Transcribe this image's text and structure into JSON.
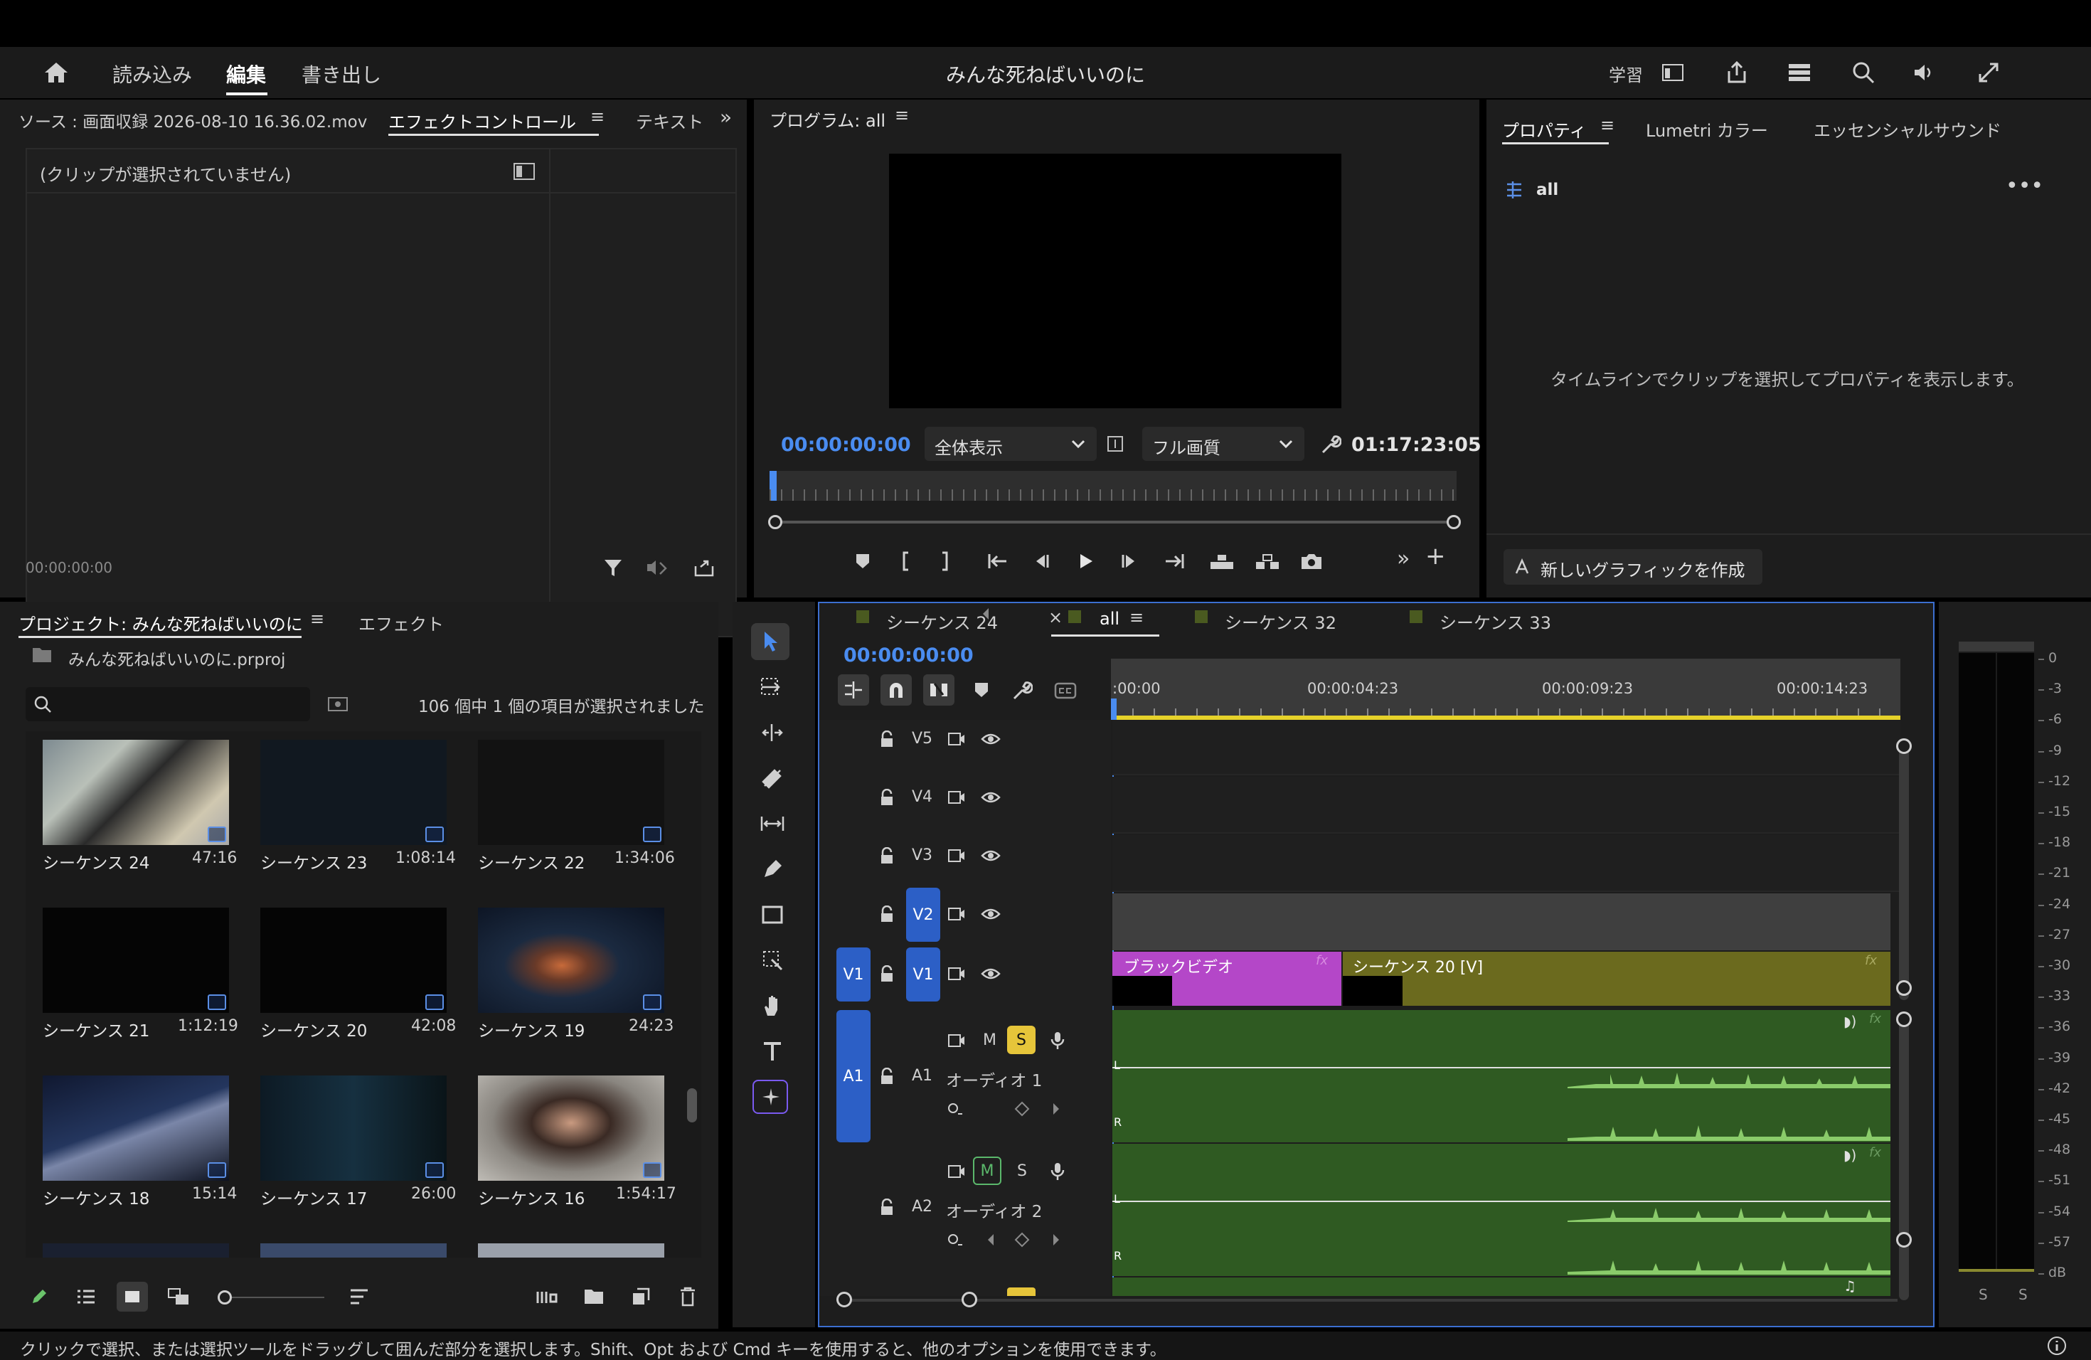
{
  "header": {
    "tabs": [
      "読み込み",
      "編集",
      "書き出し"
    ],
    "project_title": "みんな死ねばいいのに",
    "learn": "学習"
  },
  "icons": {
    "menu": "≡",
    "more": "»",
    "plus": "+",
    "ellipsis": "•••",
    "close": "×",
    "fx": "fx",
    "audio_clip": "◗)",
    "music": "♫"
  },
  "source": {
    "tabs": [
      "ソース : 画面収録 2026-08-10 16.36.02.mov",
      "エフェクトコントロール",
      "テキスト"
    ],
    "no_clip": "(クリップが選択されていません)",
    "timecode": "00:00:00:00"
  },
  "program": {
    "tab": "プログラム: all",
    "current_time": "00:00:00:00",
    "fit": "全体表示",
    "quality": "フル画質",
    "duration": "01:17:23:05"
  },
  "properties": {
    "tabs": [
      "プロパティ",
      "Lumetri カラー",
      "エッセンシャルサウンド"
    ],
    "sequence": "all",
    "hint": "タイムラインでクリップを選択してプロパティを表示します。",
    "new_graphic": "新しいグラフィックを作成"
  },
  "project": {
    "tabs": [
      "プロジェクト: みんな死ねばいいのに",
      "エフェクト"
    ],
    "file": "みんな死ねばいいのに.prproj",
    "selection": "106 個中 1 個の項目が選択されました",
    "items": [
      {
        "name": "シーケンス 24",
        "duration": "47:16"
      },
      {
        "name": "シーケンス 23",
        "duration": "1:08:14"
      },
      {
        "name": "シーケンス 22",
        "duration": "1:34:06"
      },
      {
        "name": "シーケンス 21",
        "duration": "1:12:19"
      },
      {
        "name": "シーケンス 20",
        "duration": "42:08"
      },
      {
        "name": "シーケンス 19",
        "duration": "24:23"
      },
      {
        "name": "シーケンス 18",
        "duration": "15:14"
      },
      {
        "name": "シーケンス 17",
        "duration": "26:00"
      },
      {
        "name": "シーケンス 16",
        "duration": "1:54:17"
      }
    ]
  },
  "timeline": {
    "tabs": [
      "シーケンス 24",
      "all",
      "シーケンス 32",
      "シーケンス 33"
    ],
    "current_time": "00:00:00:00",
    "ruler": [
      ":00:00",
      "00:00:04:23",
      "00:00:09:23",
      "00:00:14:23"
    ],
    "video_tracks": [
      "V5",
      "V4",
      "V3",
      "V2",
      "V1"
    ],
    "source_patch_video": "V1",
    "source_patch_audio": "A1",
    "audio_tracks": [
      {
        "id": "A1",
        "name": "オーディオ 1",
        "mute": "M",
        "solo": "S"
      },
      {
        "id": "A2",
        "name": "オーディオ 2",
        "mute": "M",
        "solo": "S"
      }
    ],
    "clips": [
      "ブラックビデオ",
      "シーケンス 20 [V]"
    ],
    "channels": [
      "L",
      "R"
    ]
  },
  "meters": {
    "scale": [
      "0",
      "-3",
      "-6",
      "-9",
      "-12",
      "-15",
      "-18",
      "-21",
      "-24",
      "-27",
      "-30",
      "-33",
      "-36",
      "-39",
      "-42",
      "-45",
      "-48",
      "-51",
      "-54",
      "-57",
      "dB"
    ],
    "solo": "S"
  },
  "status": "クリックで選択、または選択ツールをドラッグして囲んだ部分を選択します。Shift、Opt および Cmd キーを使用すると、他のオプションを使用できます。"
}
